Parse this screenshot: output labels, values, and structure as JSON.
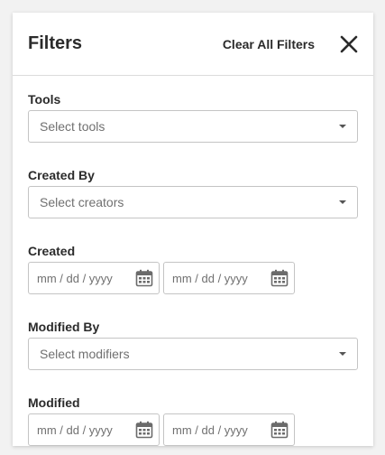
{
  "header": {
    "title": "Filters",
    "clear_label": "Clear All Filters",
    "close_icon": "close-icon"
  },
  "filters": {
    "tools": {
      "label": "Tools",
      "placeholder": "Select tools"
    },
    "created_by": {
      "label": "Created By",
      "placeholder": "Select creators"
    },
    "created": {
      "label": "Created",
      "start_placeholder": "mm / dd / yyyy",
      "end_placeholder": "mm / dd / yyyy"
    },
    "modified_by": {
      "label": "Modified By",
      "placeholder": "Select modifiers"
    },
    "modified": {
      "label": "Modified",
      "start_placeholder": "mm / dd / yyyy",
      "end_placeholder": "mm / dd / yyyy"
    }
  },
  "icons": {
    "dropdown": "chevron-down-icon",
    "calendar": "calendar-icon"
  },
  "colors": {
    "text": "#2b2b2b",
    "placeholder": "#707070",
    "border": "#c4c4c4",
    "icon": "#6b6b6b"
  }
}
